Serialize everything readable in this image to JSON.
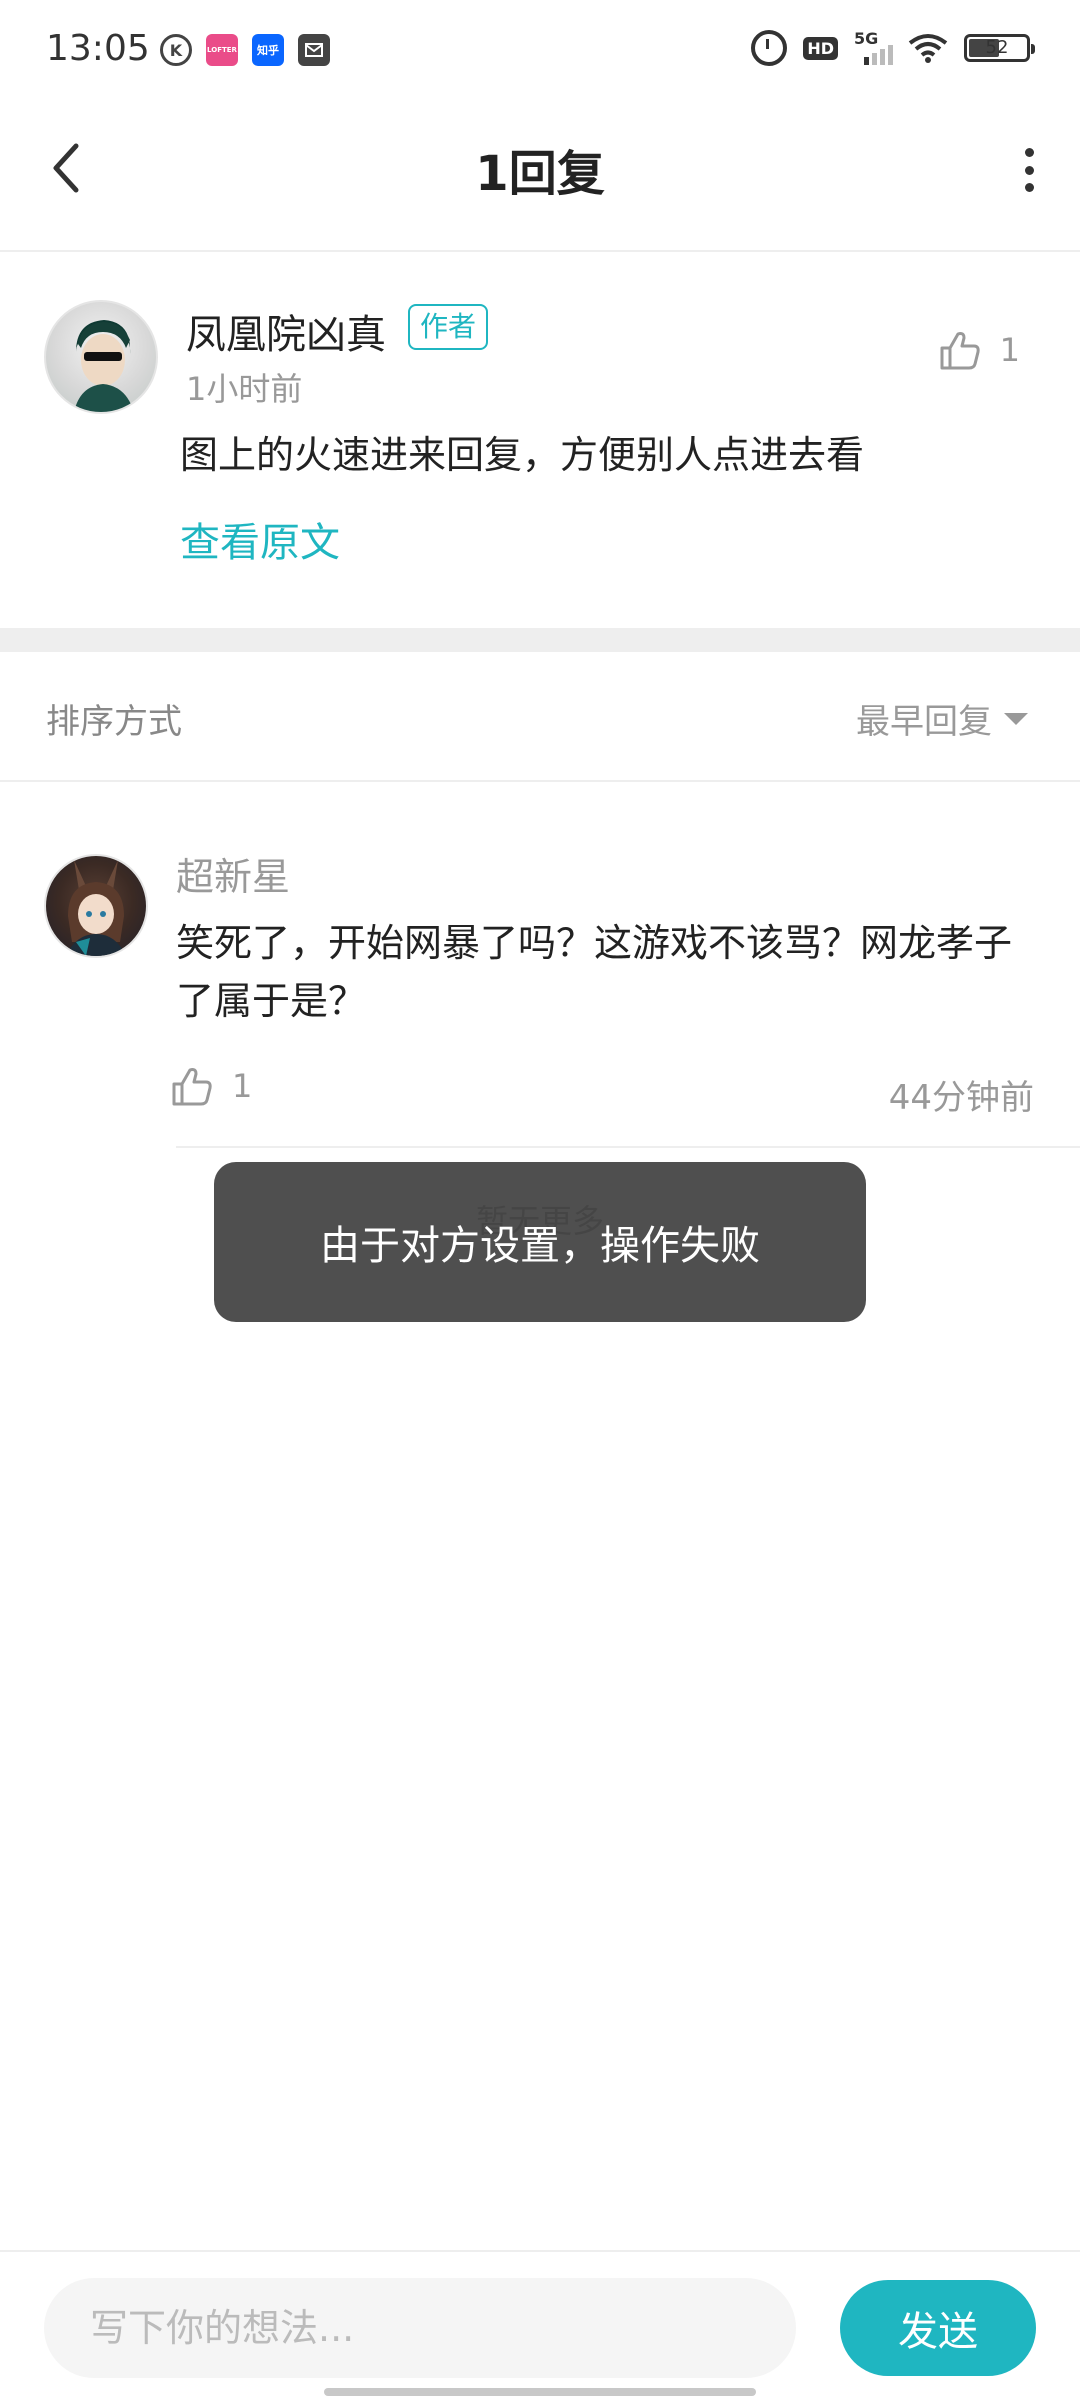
{
  "status_bar": {
    "time": "13:05",
    "battery": "52",
    "hd_label": "HD",
    "network_label": "5G",
    "app_icons": [
      "k-icon",
      "lofter-icon",
      "zhihu-icon",
      "message-icon"
    ],
    "zhihu_label": "知乎",
    "lofter_label": "LOFTER"
  },
  "header": {
    "title": "1回复",
    "back_icon": "chevron-left-icon",
    "more_icon": "more-vertical-icon"
  },
  "main_comment": {
    "author": "凤凰院凶真",
    "badge": "作者",
    "time": "1小时前",
    "like_count": "1",
    "text": "图上的火速进来回复，方便别人点进去看",
    "view_original": "查看原文"
  },
  "sort": {
    "label": "排序方式",
    "selected": "最早回复"
  },
  "replies": [
    {
      "author": "超新星",
      "text": "笑死了，开始网暴了吗？这游戏不该骂？网龙孝子了属于是？",
      "like_count": "1",
      "time": "44分钟前"
    }
  ],
  "no_more": "暂无更多",
  "toast": {
    "text": "由于对方设置，操作失败"
  },
  "bottom_bar": {
    "placeholder": "写下你的想法...",
    "send_label": "发送"
  },
  "colors": {
    "accent": "#1fb6c1",
    "toast_bg": "#3c3c3c",
    "secondary_text": "#999999"
  }
}
